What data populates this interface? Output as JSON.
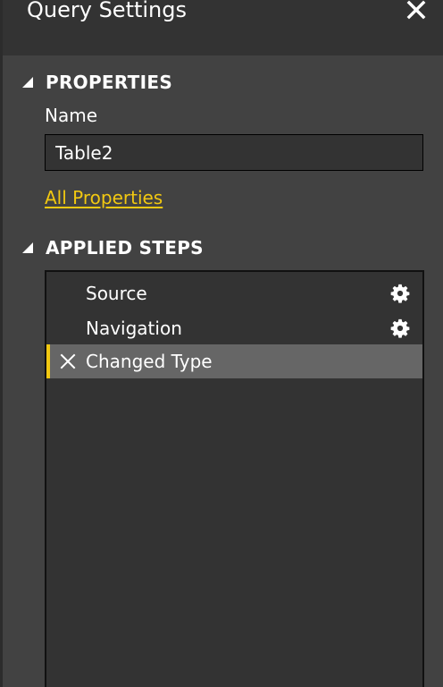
{
  "header": {
    "title": "Query Settings",
    "close_icon": "close-icon"
  },
  "properties": {
    "section_title": "PROPERTIES",
    "name_label": "Name",
    "name_value": "Table2",
    "all_properties_link": "All Properties"
  },
  "applied_steps": {
    "section_title": "APPLIED STEPS",
    "steps": [
      {
        "label": "Source",
        "icon": "gear-icon",
        "selected": false
      },
      {
        "label": "Navigation",
        "icon": "gear-icon",
        "selected": false
      },
      {
        "label": "Changed Type",
        "icon": "delete-step-icon",
        "selected": true
      }
    ]
  },
  "colors": {
    "accent": "#f2c811",
    "panel_bg": "#424242",
    "header_bg": "#333333",
    "selected_row_bg": "#666666"
  }
}
